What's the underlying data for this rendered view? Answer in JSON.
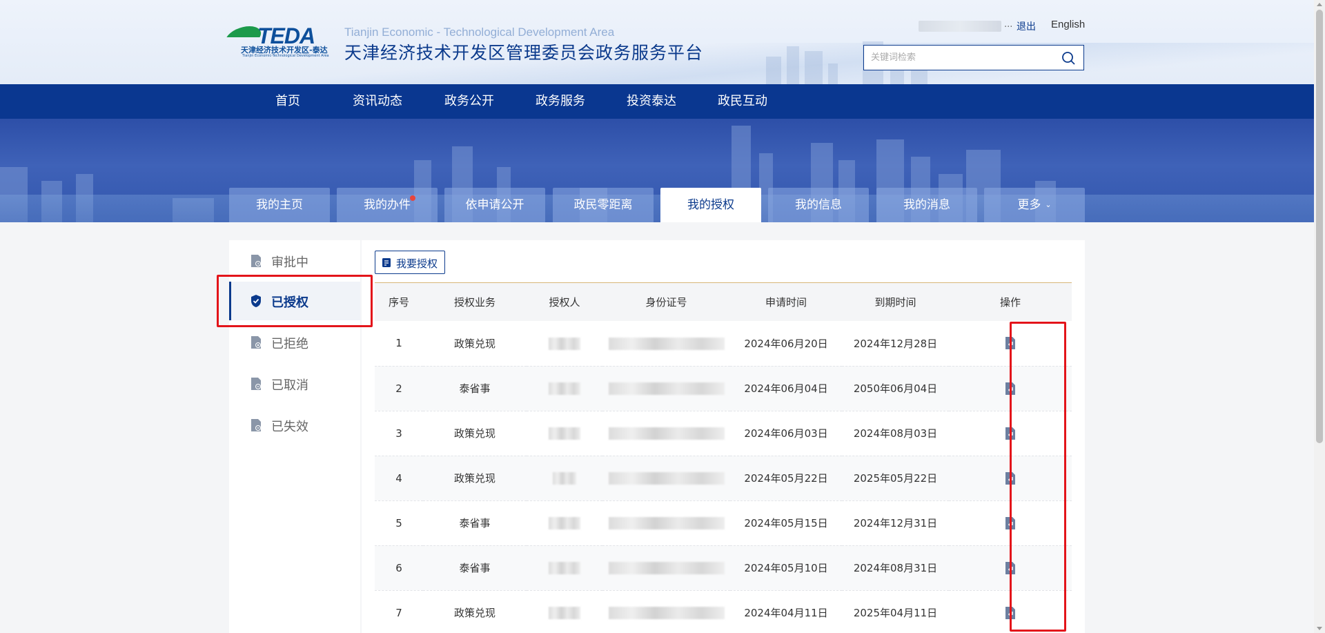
{
  "header": {
    "logo_text": "TEDA",
    "logo_cn": "天津经济技术开发区-泰达",
    "logo_en": "Tianjin Economic-Technological Development Area",
    "site_en": "Tianjin Economic - Technological Development Area",
    "site_cn": "天津经济技术开发区管理委员会政务服务平台",
    "user_ellipsis": "...",
    "logout": "退出",
    "english": "English",
    "search_placeholder": "关键词检索"
  },
  "mainnav": [
    "首页",
    "资讯动态",
    "政务公开",
    "政务服务",
    "投资泰达",
    "政民互动"
  ],
  "tabs": [
    {
      "label": "我的主页",
      "active": false
    },
    {
      "label": "我的办件",
      "active": false,
      "dot": true
    },
    {
      "label": "依申请公开",
      "active": false
    },
    {
      "label": "政民零距离",
      "active": false
    },
    {
      "label": "我的授权",
      "active": true
    },
    {
      "label": "我的信息",
      "active": false
    },
    {
      "label": "我的消息",
      "active": false
    },
    {
      "label": "更多",
      "active": false,
      "chevron": true
    }
  ],
  "sidebar": [
    {
      "label": "审批中",
      "icon": "doc-clock-icon",
      "active": false
    },
    {
      "label": "已授权",
      "icon": "shield-check-icon",
      "active": true
    },
    {
      "label": "已拒绝",
      "icon": "doc-reject-icon",
      "active": false
    },
    {
      "label": "已取消",
      "icon": "doc-cancel-icon",
      "active": false
    },
    {
      "label": "已失效",
      "icon": "doc-expired-icon",
      "active": false
    }
  ],
  "apply_button": "我要授权",
  "table": {
    "headers": [
      "序号",
      "授权业务",
      "授权人",
      "身份证号",
      "申请时间",
      "到期时间",
      "操作"
    ],
    "rows": [
      {
        "no": "1",
        "business": "政策兑现",
        "apply": "2024年06月20日",
        "expire": "2024年12月28日"
      },
      {
        "no": "2",
        "business": "泰省事",
        "apply": "2024年06月04日",
        "expire": "2050年06月04日"
      },
      {
        "no": "3",
        "business": "政策兑现",
        "apply": "2024年06月03日",
        "expire": "2024年08月03日"
      },
      {
        "no": "4",
        "business": "政策兑现",
        "apply": "2024年05月22日",
        "expire": "2025年05月22日"
      },
      {
        "no": "5",
        "business": "泰省事",
        "apply": "2024年05月15日",
        "expire": "2024年12月31日"
      },
      {
        "no": "6",
        "business": "泰省事",
        "apply": "2024年05月10日",
        "expire": "2024年08月31日"
      },
      {
        "no": "7",
        "business": "政策兑现",
        "apply": "2024年04月11日",
        "expire": "2025年04月11日"
      }
    ]
  },
  "colors": {
    "primary": "#0a3790",
    "highlight": "#e3141a",
    "accent_line": "#d7b678"
  }
}
